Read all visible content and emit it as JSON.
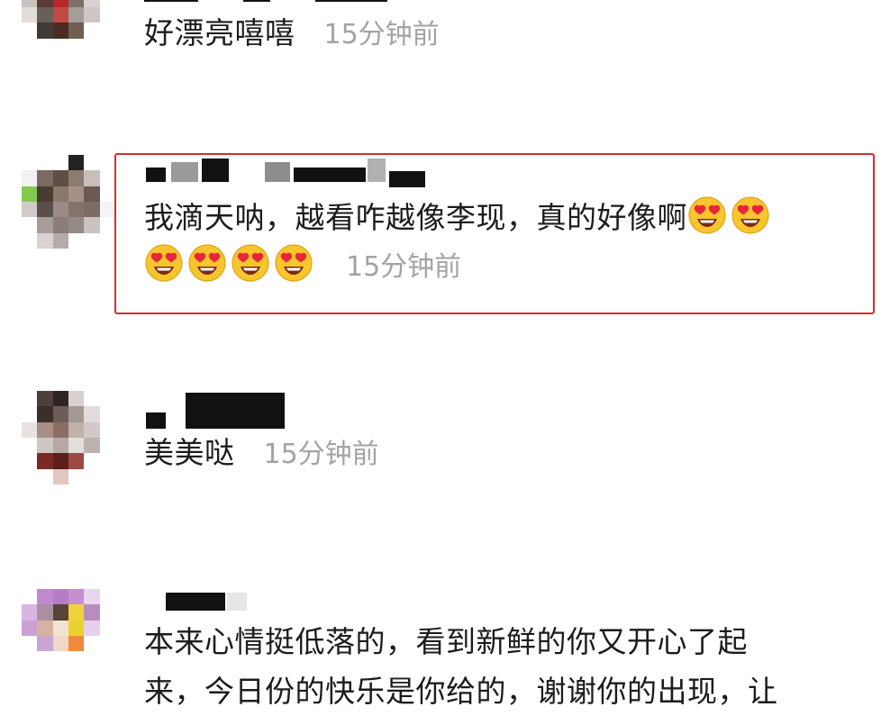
{
  "comments": [
    {
      "text": "好漂亮嘻嘻",
      "time": "15分钟前"
    },
    {
      "text_line1": "我滴天呐，越看咋越像李现，真的好像啊",
      "time": "15分钟前",
      "emoji": "heart-eyes-face",
      "emoji_count_line1": 2,
      "emoji_count_line2": 4,
      "highlight_color": "#d0302b"
    },
    {
      "text": "美美哒",
      "time": "15分钟前"
    },
    {
      "text_line1": "本来心情挺低落的，看到新鲜的你又开心了起",
      "text_line2": "来，今日份的快乐是你给的，谢谢你的出现，让"
    }
  ]
}
